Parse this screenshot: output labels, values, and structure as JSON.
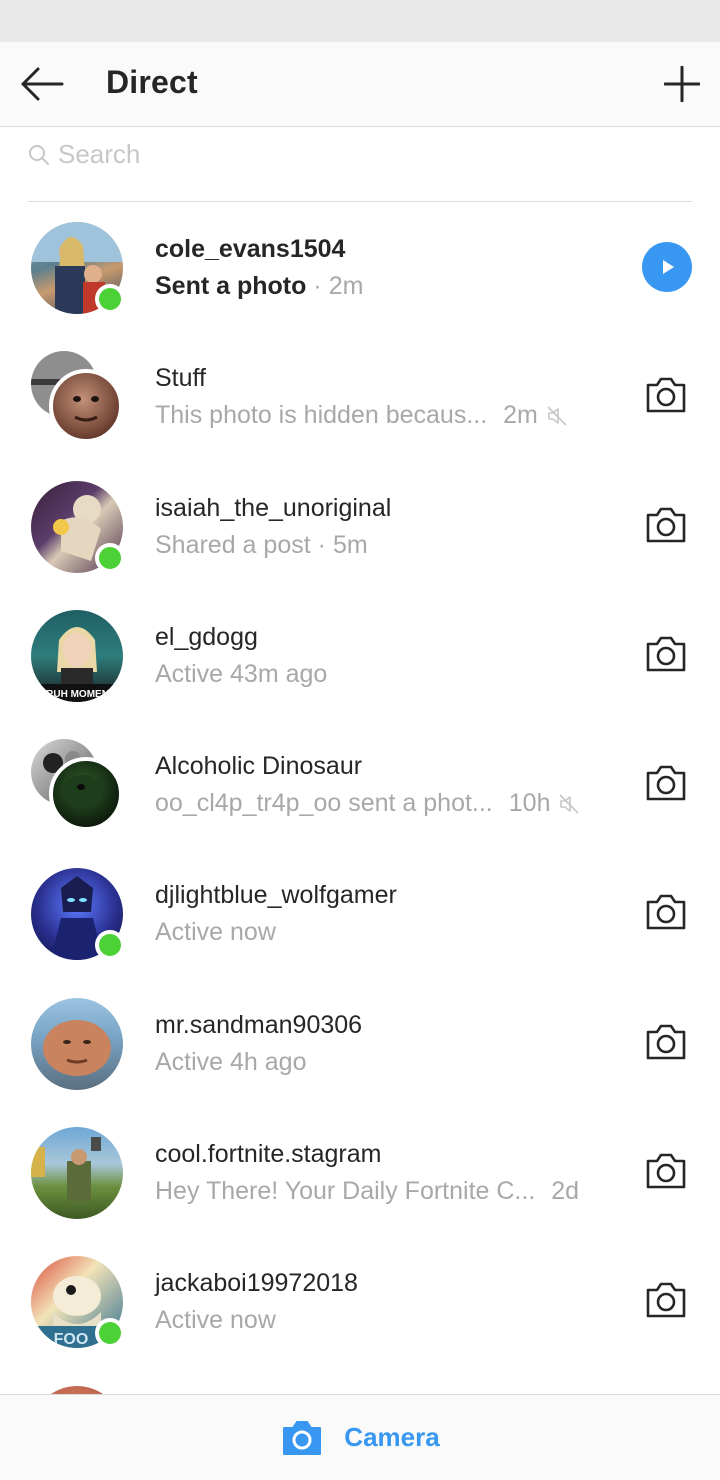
{
  "header": {
    "title": "Direct"
  },
  "search": {
    "placeholder": "Search"
  },
  "threads": [
    {
      "name": "cole_evans1504",
      "message": "Sent a photo",
      "time": "2m",
      "unread": true,
      "online": true
    },
    {
      "name": "Stuff",
      "message": "This photo is hidden becaus...",
      "time": "2m",
      "muted": true,
      "group": true
    },
    {
      "name": "isaiah_the_unoriginal",
      "message": "Shared a post",
      "time": "5m",
      "online": true
    },
    {
      "name": "el_gdogg",
      "message": "Active 43m ago"
    },
    {
      "name": "Alcoholic Dinosaur",
      "message": "oo_cl4p_tr4p_oo sent a phot...",
      "time": "10h",
      "muted": true,
      "group": true
    },
    {
      "name": "djlightblue_wolfgamer",
      "message": "Active now",
      "online": true
    },
    {
      "name": "mr.sandman90306",
      "message": "Active 4h ago"
    },
    {
      "name": "cool.fortnite.stagram",
      "message": "Hey There! Your Daily Fortnite C...",
      "time": "2d"
    },
    {
      "name": "jackaboi19972018",
      "message": "Active now",
      "online": true
    }
  ],
  "avatar_text": {
    "el_gdogg_caption": "BRUH MOMENT",
    "jackaboi_caption": "FOO"
  },
  "bottom_bar": {
    "label": "Camera"
  },
  "colors": {
    "accent": "#3897f0",
    "online": "#4cd137",
    "secondary_text": "#a8a8a8"
  }
}
